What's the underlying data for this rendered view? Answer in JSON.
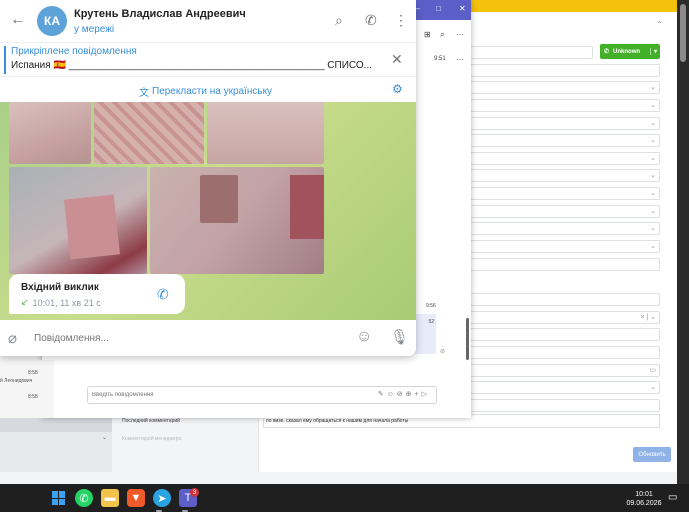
{
  "telegram": {
    "avatar_initials": "КА",
    "contact_name": "Крутень Владислав Андреевич",
    "status": "у мережі",
    "icons": {
      "back": "arrow-left-icon",
      "search": "search-icon",
      "call": "phone-icon",
      "menu": "more-vertical-icon"
    },
    "pinned": {
      "title": "Прикріплене повідомлення",
      "text": "Испания 🇪🇸 ______________________________________________ СПИСО..."
    },
    "translate_label": "Перекласти на українську",
    "call": {
      "title": "Вхідний виклик",
      "meta": "10:01, 11 хв 21 с"
    },
    "input_placeholder": "Повідомлення..."
  },
  "teams": {
    "time_right": "9:51",
    "message_time": "9:56",
    "bubble_text": "52",
    "list_times": [
      "8:58",
      "8:58"
    ],
    "list_name": "й Леонидович",
    "compose_placeholder": "Введіть повідомлення"
  },
  "crm": {
    "status_button": "Unknown",
    "comment_label": "Последний комментарий",
    "comment_value": "по визе. сказал ему обращаться к нашим для начала работы",
    "dim_label": "Комментарий менеджера",
    "update_button": "Обновить"
  },
  "taskbar": {
    "clock_time": "10:01",
    "clock_date": "09.06.2026",
    "teams_badge": "3"
  },
  "colors": {
    "telegram_accent": "#3a8fd8",
    "teams_purple": "#5b5fc7",
    "crm_green": "#43b02a",
    "crm_yellow": "#f4c20d"
  }
}
